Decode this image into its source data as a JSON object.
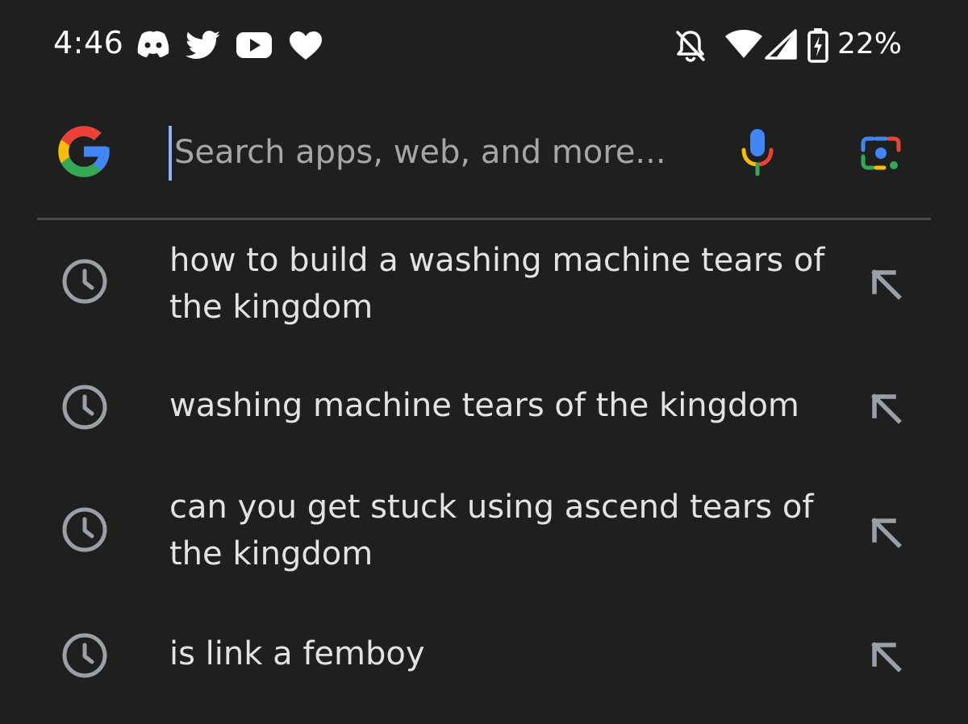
{
  "status_bar": {
    "time": "4:46",
    "notification_icons": [
      "discord-icon",
      "twitter-icon",
      "youtube-icon",
      "heart-icon"
    ],
    "system_icons": [
      "bell-off-icon",
      "wifi-icon",
      "signal-icon",
      "battery-charging-icon"
    ],
    "battery_percent": "22%"
  },
  "search": {
    "placeholder": "Search apps, web, and more...",
    "value": ""
  },
  "suggestions": [
    {
      "text": "how to build a washing machine tears of the kingdom"
    },
    {
      "text": "washing machine tears of the kingdom"
    },
    {
      "text": "can you get stuck using ascend tears of the kingdom"
    },
    {
      "text": "is link a femboy"
    }
  ],
  "colors": {
    "background": "#1f1f1f",
    "text": "#e3e3e3",
    "placeholder": "#a6a6a6",
    "icon_gray": "#9aa0a6",
    "divider": "#4b4b4b",
    "google_blue": "#4285f4",
    "google_red": "#ea4335",
    "google_yellow": "#fbbc05",
    "google_green": "#34a853",
    "caret": "#8ab4f8"
  }
}
